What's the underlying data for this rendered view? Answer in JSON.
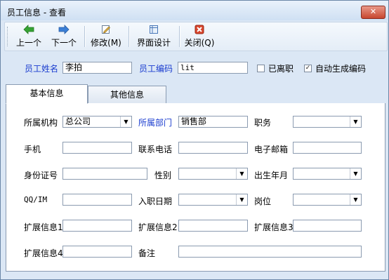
{
  "window": {
    "title": "员工信息 - 查看",
    "close_label": "✕"
  },
  "toolbar": {
    "prev_label": "上一个",
    "next_label": "下一个",
    "edit_label": "修改(M)",
    "design_label": "界面设计",
    "close_label": "关闭(Q)"
  },
  "header": {
    "name_label": "员工姓名",
    "name_value": "李拍",
    "code_label": "员工编码",
    "code_value": "lit",
    "resigned_label": "已离职",
    "resigned_checked": false,
    "autocode_label": "自动生成编码",
    "autocode_checked": true
  },
  "tabs": {
    "basic": "基本信息",
    "other": "其他信息"
  },
  "basic": {
    "org_label": "所属机构",
    "org_value": "总公司",
    "dept_label": "所属部门",
    "dept_value": "销售部",
    "position_label": "职务",
    "position_value": "",
    "mobile_label": "手机",
    "mobile_value": "",
    "phone_label": "联系电话",
    "phone_value": "",
    "email_label": "电子邮箱",
    "email_value": "",
    "idcard_label": "身份证号",
    "idcard_value": "",
    "gender_label": "性别",
    "gender_value": "",
    "birth_label": "出生年月",
    "birth_value": "",
    "qq_label": "QQ/IM",
    "qq_value": "",
    "hire_label": "入职日期",
    "hire_value": "",
    "post_label": "岗位",
    "post_value": "",
    "ext1_label": "扩展信息1",
    "ext1_value": "",
    "ext2_label": "扩展信息2",
    "ext2_value": "",
    "ext3_label": "扩展信息3",
    "ext3_value": "",
    "ext4_label": "扩展信息4",
    "ext4_value": "",
    "remark_label": "备注",
    "remark_value": ""
  },
  "colors": {
    "link_blue": "#1a3ccf",
    "arrow_green": "#36a334",
    "arrow_blue": "#3b7fd6",
    "close_red": "#d8452c"
  },
  "icons": {
    "prev": "green-left-arrow-icon",
    "next": "blue-right-arrow-icon",
    "edit": "edit-document-icon",
    "design": "layout-design-icon",
    "close": "red-close-icon",
    "dropdown": "dropdown-arrow-icon"
  }
}
